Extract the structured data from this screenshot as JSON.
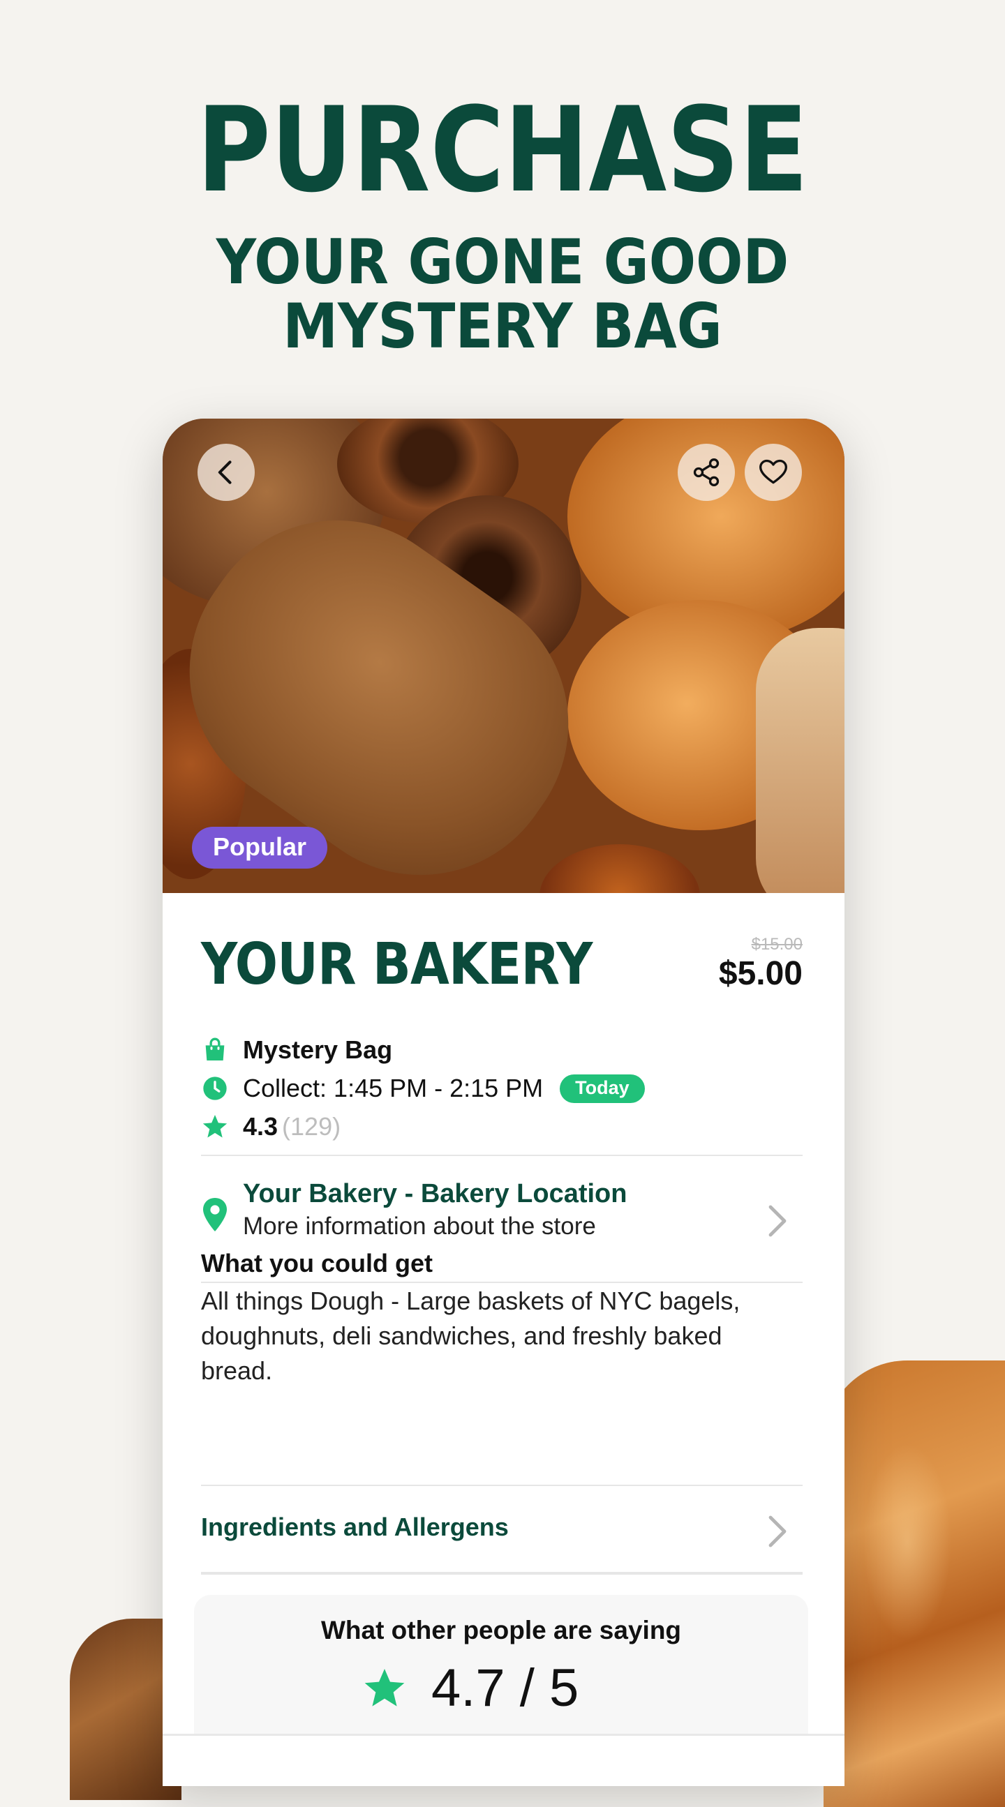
{
  "headline": {
    "line1": "PURCHASE",
    "line2": "YOUR GONE GOOD",
    "line3": "MYSTERY BAG"
  },
  "hero": {
    "badge": "Popular",
    "back_icon": "chevron-left-icon",
    "share_icon": "share-icon",
    "favorite_icon": "heart-icon"
  },
  "store": {
    "name": "YOUR BAKERY",
    "original_price": "$15.00",
    "price": "$5.00"
  },
  "details": {
    "bag_type": "Mystery Bag",
    "collect": "Collect: 1:45 PM - 2:15 PM",
    "collect_badge": "Today",
    "rating": "4.3",
    "rating_count": "(129)"
  },
  "location": {
    "title": "Your Bakery -  Bakery Location",
    "subtitle": "More information about the store"
  },
  "what_you_get": {
    "title": "What you could get",
    "description": "All things Dough - Large baskets of NYC bagels, doughnuts, deli sandwiches, and freshly baked bread."
  },
  "ingredients": {
    "label": "Ingredients and Allergens"
  },
  "reviews": {
    "title": "What other people are saying",
    "score": "4.7 / 5"
  },
  "colors": {
    "brand_green": "#0b4a3b",
    "accent_green": "#21c17a",
    "badge_purple": "#7a57d6",
    "background": "#f5f3ef"
  }
}
